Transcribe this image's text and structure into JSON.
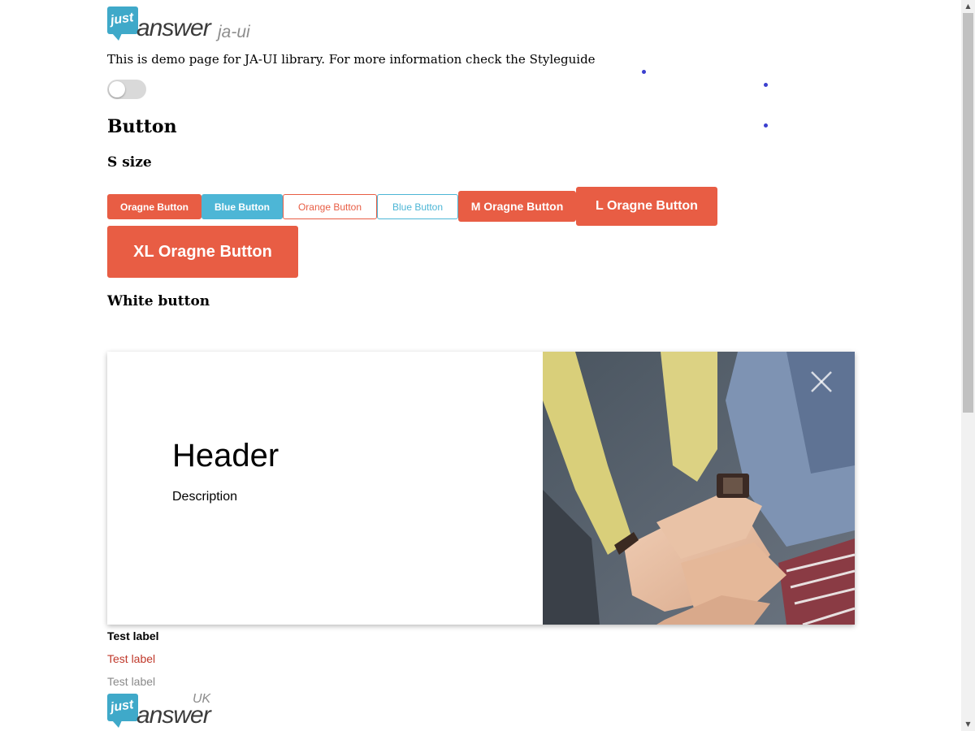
{
  "logo": {
    "bubble_text": "just",
    "wordmark": "answer",
    "suffix": "ja-ui"
  },
  "intro": "This is demo page for JA-UI library. For more information check the Styleguide",
  "toggle": {
    "checked": false
  },
  "sections": {
    "button_title": "Button",
    "s_size_title": "S size",
    "white_button_title": "White button"
  },
  "buttons": {
    "s_orange": "Oragne Button",
    "s_blue": "Blue Button",
    "s_orange_outline": "Orange Button",
    "s_blue_outline": "Blue Button",
    "m_orange": "M Oragne Button",
    "l_orange": "L Oragne Button",
    "xl_orange": "XL Oragne Button"
  },
  "card": {
    "header": "Header",
    "description": "Description",
    "close_icon": "close-icon",
    "image": "hands-stacked-photo"
  },
  "labels": [
    "Test label",
    "Test label",
    "Test label"
  ],
  "footer_logo": {
    "bubble_text": "just",
    "wordmark": "answer",
    "region": "UK"
  },
  "colors": {
    "orange": "#e85d44",
    "blue": "#4db6d6",
    "brand_teal": "#3fa9c9",
    "label_red": "#c0392b",
    "label_grey": "#8a8a8a"
  }
}
